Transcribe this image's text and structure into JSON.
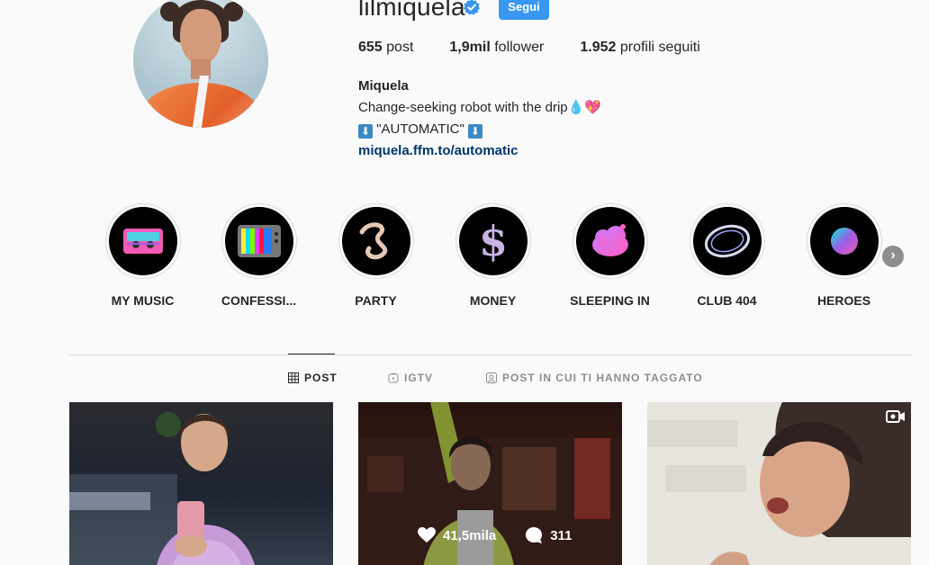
{
  "profile": {
    "username": "lilmiquela",
    "follow_label": "Segui",
    "stats": [
      {
        "value": "655",
        "label": "post"
      },
      {
        "value": "1,9mil",
        "label": "follower"
      },
      {
        "value": "1.952",
        "label": "profili seguiti"
      }
    ],
    "bio": {
      "name": "Miquela",
      "line1": "Change-seeking robot with the drip💧💖",
      "line2_text": "\"AUTOMATIC\"",
      "line2_arrow": "⬇",
      "link": "miquela.ffm.to/automatic"
    }
  },
  "highlights": [
    {
      "label": "MY MUSIC",
      "icon": "cassette-icon"
    },
    {
      "label": "CONFESSI...",
      "icon": "tv-icon"
    },
    {
      "label": "PARTY",
      "icon": "squiggle-icon"
    },
    {
      "label": "MONEY",
      "icon": "dollar-icon"
    },
    {
      "label": "SLEEPING IN",
      "icon": "cloud-icon"
    },
    {
      "label": "CLUB 404",
      "icon": "ring-icon"
    },
    {
      "label": "HEROES",
      "icon": "orb-icon"
    }
  ],
  "tabs": [
    {
      "label": "POST",
      "active": true
    },
    {
      "label": "IGTV",
      "active": false
    },
    {
      "label": "POST IN CUI TI HANNO TAGGATO",
      "active": false
    }
  ],
  "posts": [
    {
      "likes": "",
      "comments": ""
    },
    {
      "likes": "41,5mila",
      "comments": "311"
    },
    {
      "likes": "",
      "comments": ""
    }
  ],
  "colors": {
    "accent": "#3897f0",
    "verified": "#3897f0",
    "link": "#00376b"
  }
}
